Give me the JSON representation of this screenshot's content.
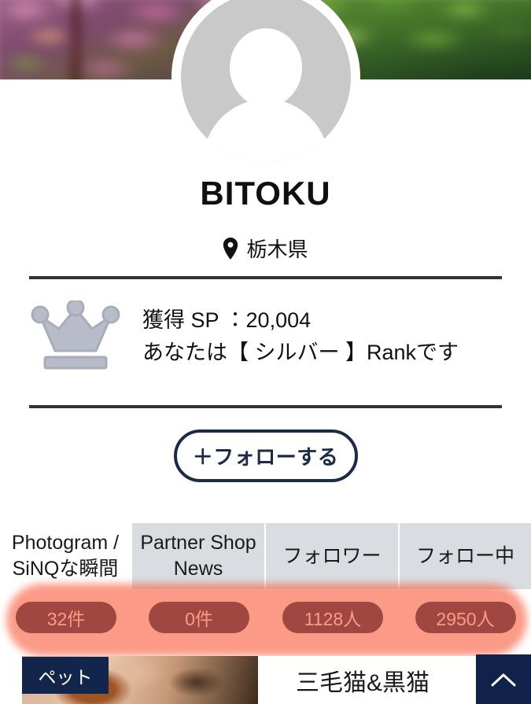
{
  "profile": {
    "name": "BITOKU",
    "location": "栃木県",
    "location_icon": "map-pin-icon",
    "avatar_icon": "default-avatar-icon",
    "cover_photo_alt": "blurred flower and foliage cover photo"
  },
  "rank": {
    "crown_icon": "crown-icon",
    "sp_line": "獲得 SP ：20,004",
    "rank_line": "あなたは【 シルバー 】Rankです",
    "sp_label": "獲得 SP",
    "sp_value": "20,004",
    "rank_tier": "シルバー"
  },
  "actions": {
    "follow_label": "＋フォローする"
  },
  "tabs": [
    {
      "label": "Photogram / SiNQな瞬間",
      "count": "32件",
      "active": true
    },
    {
      "label": "Partner Shop News",
      "count": "0件",
      "active": false
    },
    {
      "label": "フォロワー",
      "count": "1128人",
      "active": false
    },
    {
      "label": "フォロー中",
      "count": "2950人",
      "active": false
    }
  ],
  "post": {
    "category_tag": "ペット",
    "title": "三毛猫&黒猫"
  },
  "scroll_top": {
    "icon": "chevron-up-icon",
    "glyph": "∧"
  },
  "colors": {
    "navy": "#14254c",
    "highlighter": "#f85c3c",
    "tab_inactive_bg": "#d9dde1",
    "divider": "#333333",
    "crown": "#b8bcc8"
  }
}
